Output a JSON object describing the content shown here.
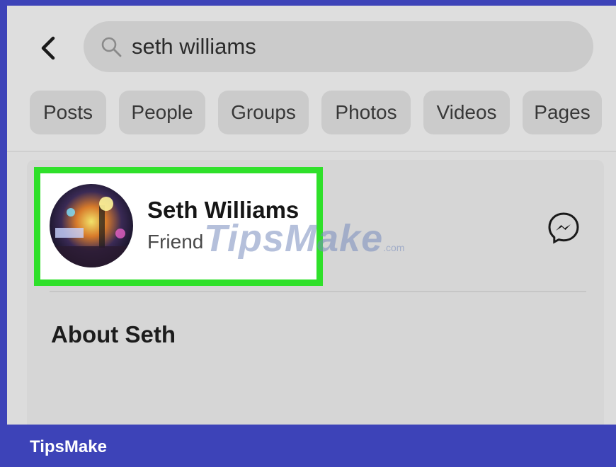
{
  "search": {
    "value": "seth williams"
  },
  "tabs": [
    "Posts",
    "People",
    "Groups",
    "Photos",
    "Videos",
    "Pages"
  ],
  "result": {
    "name": "Seth Williams",
    "subtitle": "Friend"
  },
  "section": {
    "title": "About Seth"
  },
  "watermark": {
    "text": "TipsMake",
    "suffix": ".com"
  },
  "footer": {
    "brand": "TipsMake"
  },
  "colors": {
    "frame": "#3d43b8",
    "highlight": "#2fe02a",
    "screen_bg": "#dcdcdc"
  },
  "icons": {
    "back": "chevron-left-icon",
    "search": "search-icon",
    "message": "messenger-icon"
  }
}
